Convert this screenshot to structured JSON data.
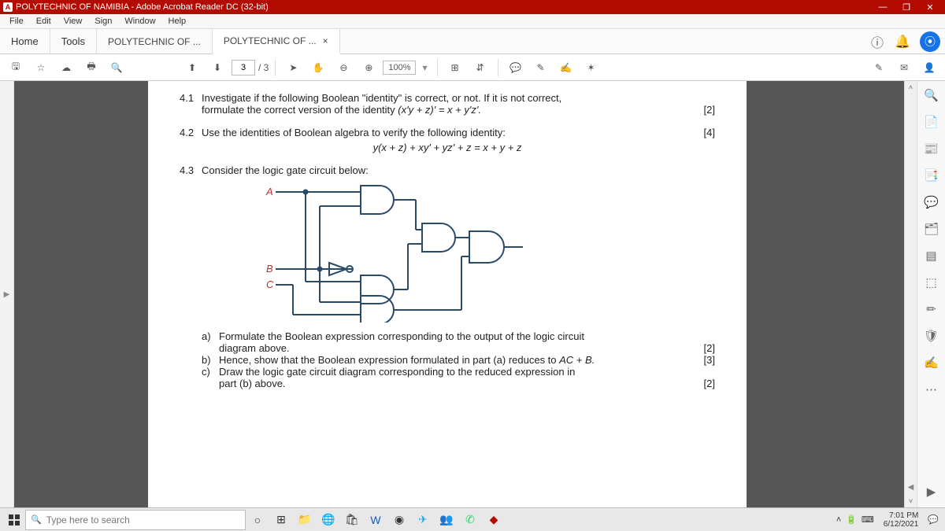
{
  "window": {
    "title": "POLYTECHNIC OF NAMIBIA - Adobe Acrobat Reader DC (32-bit)",
    "minimize": "—",
    "maximize": "❐",
    "close": "✕"
  },
  "menu": {
    "items": [
      "File",
      "Edit",
      "View",
      "Sign",
      "Window",
      "Help"
    ]
  },
  "tabs": {
    "home": "Home",
    "tools": "Tools",
    "docs": [
      {
        "label": "POLYTECHNIC OF ...",
        "active": false
      },
      {
        "label": "POLYTECHNIC OF ...",
        "active": true
      }
    ],
    "close_x": "×"
  },
  "toolbar": {
    "page_current": "3",
    "page_sep": "/ 3",
    "zoom": "100%"
  },
  "doc": {
    "q41_num": "4.1",
    "q41_a": "Investigate if the following Boolean \"identity\" is correct, or not. If it is not correct,",
    "q41_b": "formulate the correct version of the identity ",
    "q41_eq": "(x'y + z)' = x + y'z'.",
    "q41_mark": "[2]",
    "q42_num": "4.2",
    "q42_a": "Use the identities of Boolean algebra to verify the following identity:",
    "q42_eq": "y(x + z) + xy' + yz' + z = x + y + z",
    "q42_mark": "[4]",
    "q43_num": "4.3",
    "q43_a": "Consider the logic gate circuit below:",
    "labelA": "A",
    "labelB": "B",
    "labelC": "C",
    "sa_lbl": "a)",
    "sa_1": "Formulate the Boolean expression corresponding to the output of the logic circuit",
    "sa_2": "diagram above.",
    "sa_mark": "[2]",
    "sb_lbl": "b)",
    "sb_1": "Hence, show that the Boolean expression formulated in part (a) reduces to ",
    "sb_eq": "AC + B.",
    "sb_mark": "[3]",
    "sc_lbl": "c)",
    "sc_1": "Draw the logic gate circuit diagram corresponding to the reduced expression in",
    "sc_2": "part (b) above.",
    "sc_mark": "[2]"
  },
  "taskbar": {
    "search_placeholder": "Type here to search",
    "time": "7:01 PM",
    "date": "6/12/2021"
  }
}
